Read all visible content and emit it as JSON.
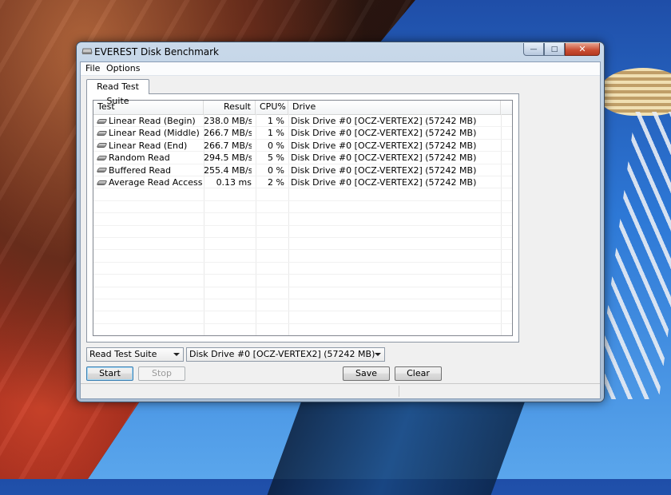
{
  "window": {
    "title": "EVEREST Disk Benchmark",
    "controls": {
      "minimize": "—",
      "maximize": "□",
      "close": "✕"
    }
  },
  "menu": [
    "File",
    "Options"
  ],
  "tab": {
    "label": "Read Test Suite"
  },
  "table": {
    "columns": [
      "Test",
      "Result",
      "CPU%",
      "Drive"
    ],
    "rows": [
      {
        "test": "Linear Read (Begin)",
        "result": "238.0 MB/s",
        "cpu": "1 %",
        "drive": "Disk Drive #0  [OCZ-VERTEX2]  (57242 MB)"
      },
      {
        "test": "Linear Read (Middle)",
        "result": "266.7 MB/s",
        "cpu": "1 %",
        "drive": "Disk Drive #0  [OCZ-VERTEX2]  (57242 MB)"
      },
      {
        "test": "Linear Read (End)",
        "result": "266.7 MB/s",
        "cpu": "0 %",
        "drive": "Disk Drive #0  [OCZ-VERTEX2]  (57242 MB)"
      },
      {
        "test": "Random Read",
        "result": "294.5 MB/s",
        "cpu": "5 %",
        "drive": "Disk Drive #0  [OCZ-VERTEX2]  (57242 MB)"
      },
      {
        "test": "Buffered Read",
        "result": "255.4 MB/s",
        "cpu": "0 %",
        "drive": "Disk Drive #0  [OCZ-VERTEX2]  (57242 MB)"
      },
      {
        "test": "Average Read Access",
        "result": "0.13 ms",
        "cpu": "2 %",
        "drive": "Disk Drive #0  [OCZ-VERTEX2]  (57242 MB)"
      }
    ]
  },
  "controls": {
    "suite_select": "Read Test Suite",
    "drive_select": "Disk Drive #0  [OCZ-VERTEX2]  (57242 MB)",
    "start": "Start",
    "stop": "Stop",
    "save": "Save",
    "clear": "Clear"
  },
  "icons": {
    "app": "disk-icon",
    "row": "hard-drive-icon"
  }
}
